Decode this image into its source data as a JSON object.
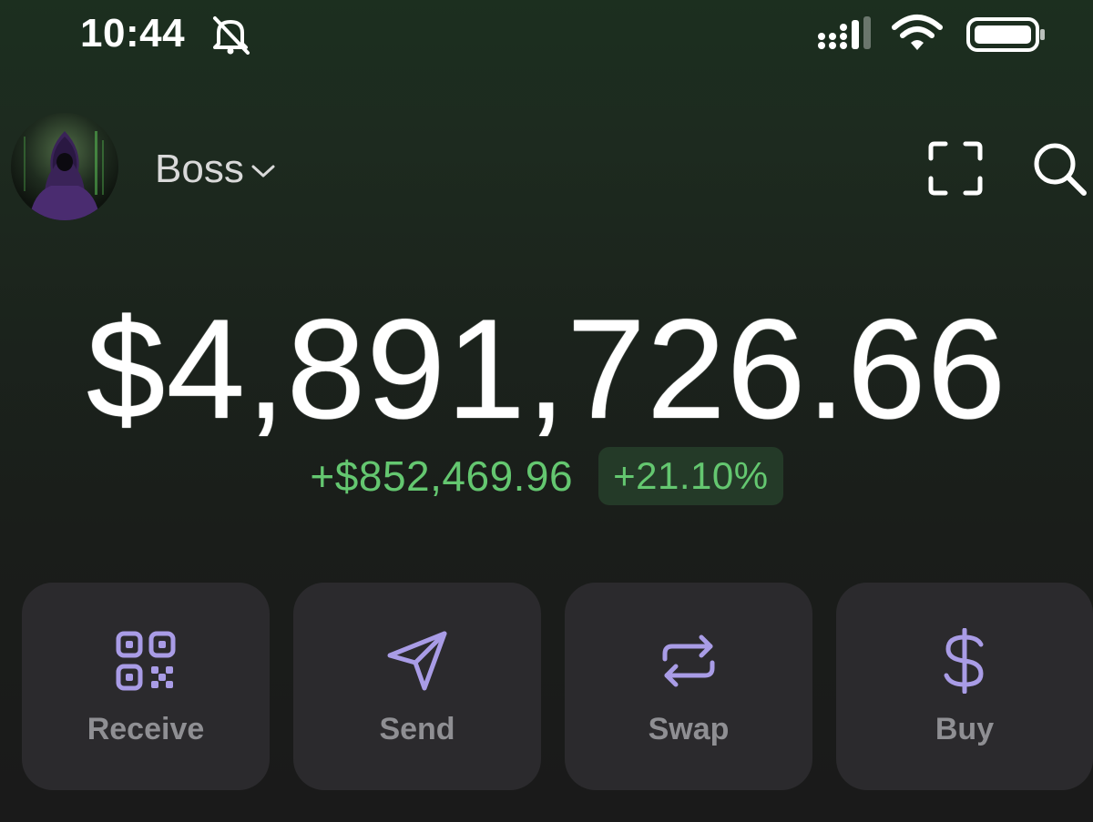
{
  "status_bar": {
    "time": "10:44",
    "icons": [
      "bell-off-icon",
      "signal-icon",
      "wifi-icon",
      "battery-icon"
    ]
  },
  "header": {
    "account_name": "Boss",
    "icons": [
      "avatar",
      "chevron-down-icon",
      "scan-icon",
      "search-icon"
    ]
  },
  "portfolio": {
    "balance": "$4,891,726.66",
    "change_amount": "+$852,469.96",
    "change_percent": "+21.10%"
  },
  "actions": [
    {
      "label": "Receive",
      "icon": "qr-code-icon"
    },
    {
      "label": "Send",
      "icon": "send-icon"
    },
    {
      "label": "Swap",
      "icon": "swap-icon"
    },
    {
      "label": "Buy",
      "icon": "dollar-icon"
    }
  ],
  "colors": {
    "positive": "#64c770",
    "positive_bg": "#243a28",
    "accent_icon": "#a99ce6",
    "card_bg": "#2b2a2d",
    "label_text": "#8f8f93"
  }
}
